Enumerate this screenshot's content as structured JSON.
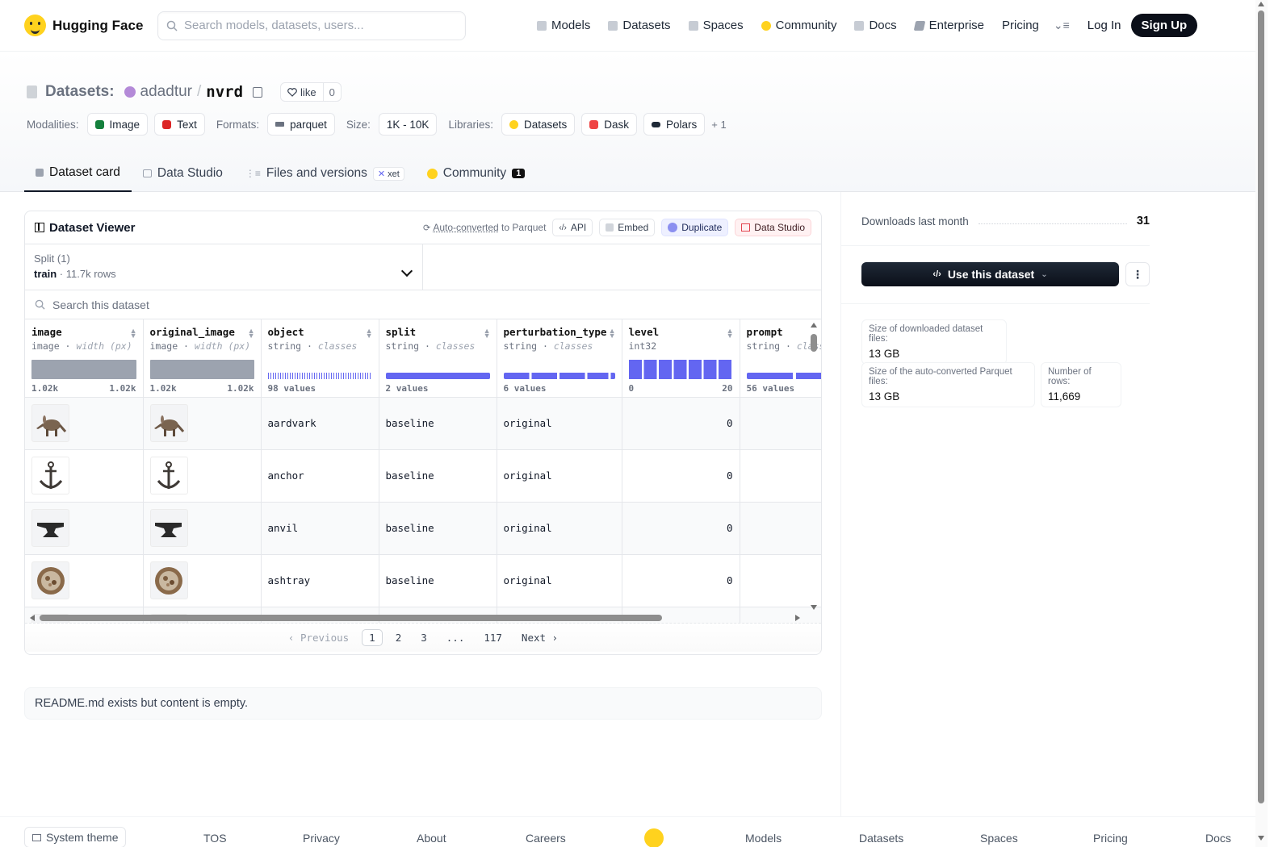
{
  "nav": {
    "brand": "Hugging Face",
    "search_placeholder": "Search models, datasets, users...",
    "links": [
      "Models",
      "Datasets",
      "Spaces",
      "Community",
      "Docs",
      "Enterprise",
      "Pricing"
    ],
    "login": "Log In",
    "signup": "Sign Up"
  },
  "repo": {
    "section": "Datasets:",
    "owner": "adadtur",
    "slash": "/",
    "name": "nvrd",
    "like_label": "like",
    "like_count": "0"
  },
  "meta": {
    "modalities_label": "Modalities:",
    "modalities": [
      "Image",
      "Text"
    ],
    "formats_label": "Formats:",
    "formats": [
      "parquet"
    ],
    "size_label": "Size:",
    "size": "1K - 10K",
    "libraries_label": "Libraries:",
    "libraries": [
      "Datasets",
      "Dask",
      "Polars"
    ],
    "libraries_more": "+ 1"
  },
  "tabs": {
    "dataset_card": "Dataset card",
    "data_studio": "Data Studio",
    "files": "Files and versions",
    "xet": "xet",
    "community": "Community",
    "community_count": "1"
  },
  "viewer": {
    "title": "Dataset Viewer",
    "auto_converted": "Auto-converted",
    "to_parquet": "to Parquet",
    "api": "API",
    "embed": "Embed",
    "duplicate": "Duplicate",
    "data_studio": "Data Studio",
    "split_label": "Split (1)",
    "split_name": "train",
    "split_rows": "11.7k rows",
    "search_placeholder": "Search this dataset",
    "columns": [
      {
        "name": "image",
        "type": "image",
        "sub": "width (px)",
        "min": "1.02k",
        "max": "1.02k"
      },
      {
        "name": "original_image",
        "type": "image",
        "sub": "width (px)",
        "min": "1.02k",
        "max": "1.02k"
      },
      {
        "name": "object",
        "type": "string",
        "sub": "classes",
        "values": "98 values"
      },
      {
        "name": "split",
        "type": "string",
        "sub": "classes",
        "values": "2 values"
      },
      {
        "name": "perturbation_type",
        "type": "string",
        "sub": "classes",
        "values": "6 values"
      },
      {
        "name": "level",
        "type": "int32",
        "sub": "",
        "min": "0",
        "max": "20"
      },
      {
        "name": "prompt",
        "type": "string",
        "sub": "classes",
        "values": "56 values"
      }
    ],
    "rows": [
      {
        "object": "aardvark",
        "split": "baseline",
        "perturbation_type": "original",
        "level": "0",
        "thumb": "aardvark-icon"
      },
      {
        "object": "anchor",
        "split": "baseline",
        "perturbation_type": "original",
        "level": "0",
        "thumb": "anchor-icon"
      },
      {
        "object": "anvil",
        "split": "baseline",
        "perturbation_type": "original",
        "level": "0",
        "thumb": "anvil-icon"
      },
      {
        "object": "ashtray",
        "split": "baseline",
        "perturbation_type": "original",
        "level": "0",
        "thumb": "ashtray-icon"
      }
    ],
    "pager": {
      "previous": "Previous",
      "pages": [
        "1",
        "2",
        "3",
        "...",
        "117"
      ],
      "current": "1",
      "next": "Next"
    }
  },
  "readme": "README.md exists but content is empty.",
  "sidebar": {
    "downloads_label": "Downloads last month",
    "downloads_value": "31",
    "use_dataset": "Use this dataset",
    "download_size_label": "Size of downloaded dataset files:",
    "download_size": "13 GB",
    "parquet_size_label": "Size of the auto-converted Parquet files:",
    "parquet_size": "13 GB",
    "rows_label": "Number of rows:",
    "rows_value": "11,669"
  },
  "footer": {
    "theme": "System theme",
    "links": [
      "TOS",
      "Privacy",
      "About",
      "Careers",
      "Models",
      "Datasets",
      "Spaces",
      "Pricing",
      "Docs"
    ]
  },
  "colors": {
    "accent": "#6366f1",
    "brand_yellow": "#FFD21E",
    "dark_button": "#0b0f19"
  }
}
